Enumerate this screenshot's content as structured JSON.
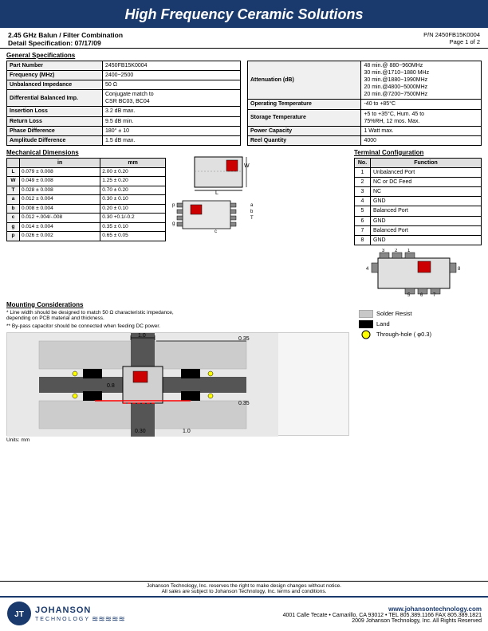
{
  "header": {
    "title": "High Frequency Ceramic Solutions"
  },
  "title_bar": {
    "product": "2.45 GHz Balun / Filter Combination",
    "part_number": "P/N 2450FB15K0004",
    "detail_spec": "Detail Specification:  07/17/09",
    "page": "Page 1 of 2"
  },
  "general_specs": {
    "title": "General Specifications",
    "left_table": [
      {
        "label": "Part Number",
        "value": "2450FB15K0004"
      },
      {
        "label": "Frequency (MHz)",
        "value": "2400~2500"
      },
      {
        "label": "Unbalanced Impedance",
        "value": "50 Ω"
      },
      {
        "label": "Differential Balanced Imp.",
        "value": "Conjugate match to\nCSR BC03, BC04"
      },
      {
        "label": "Insertion Loss",
        "value": "3.2 dB max."
      },
      {
        "label": "Return Loss",
        "value": "9.5 dB min."
      },
      {
        "label": "Phase Difference",
        "value": "180° ± 10"
      },
      {
        "label": "Amplitude Difference",
        "value": "1.5 dB max."
      }
    ],
    "right_table": [
      {
        "label": "Attenuation (dB)",
        "values": [
          "48 min.@ 880~960MHz",
          "30 min.@1710~1880 MHz",
          "30 min.@1880~1990MHz",
          "20 min.@4800~5000MHz",
          "20 min.@7200~7500MHz"
        ]
      },
      {
        "label": "Operating Temperature",
        "value": "-40 to +85°C"
      },
      {
        "label": "Storage Temperature",
        "value": "+5 to +35°C, Hum. 45 to\n75%RH, 12 mos. Max."
      },
      {
        "label": "Power Capacity",
        "value": "1 Watt max."
      },
      {
        "label": "Reel Quantity",
        "value": "4000"
      }
    ]
  },
  "mechanical": {
    "title": "Mechanical Dimensions",
    "dims_header": [
      "",
      "in",
      "mm"
    ],
    "dims": [
      {
        "label": "L",
        "in": "0.079  ±  0.008",
        "mm": "2.00  ±  0.20"
      },
      {
        "label": "W",
        "in": "0.049  ±  0.008",
        "mm": "1.25  ±  0.20"
      },
      {
        "label": "T",
        "in": "0.028  ±  0.008",
        "mm": "0.70  ±  0.20"
      },
      {
        "label": "a",
        "in": "0.012  ±  0.004",
        "mm": "0.30  ±  0.10"
      },
      {
        "label": "b",
        "in": "0.008  ±  0.004",
        "mm": "0.20  ±  0.10"
      },
      {
        "label": "c",
        "in": "0.012 +.004/-.008",
        "mm": "0.30  +0.1/-0.2"
      },
      {
        "label": "g",
        "in": "0.014  ±  0.004",
        "mm": "0.35  ±  0.10"
      },
      {
        "label": "p",
        "in": "0.026  ±  0.002",
        "mm": "0.65  ±  0.05"
      }
    ]
  },
  "terminal": {
    "title": "Terminal Configuration",
    "header": [
      "No.",
      "Function"
    ],
    "rows": [
      {
        "no": "1",
        "function": "Unbalanced Port"
      },
      {
        "no": "2",
        "function": "NC or DC Feed"
      },
      {
        "no": "3",
        "function": "NC"
      },
      {
        "no": "4",
        "function": "GND"
      },
      {
        "no": "5",
        "function": "Balanced Port"
      },
      {
        "no": "6",
        "function": "GND"
      },
      {
        "no": "7",
        "function": "Balanced Port"
      },
      {
        "no": "8",
        "function": "GND"
      }
    ]
  },
  "mounting": {
    "title": "Mounting Considerations",
    "notes": [
      "* Line width should be designed to match 50 Ω characteristic impedance, depending on PCB material and thickness.",
      "** By-pass capacitor should be connected when feeding DC power."
    ],
    "units": "Units: mm",
    "legend": [
      {
        "label": "Solder Resist",
        "color": "#c8c8c8"
      },
      {
        "label": "Land",
        "color": "#000000"
      },
      {
        "label": "Through-hole ( φ0.3)",
        "symbol": "circle"
      }
    ]
  },
  "footer": {
    "notice1": "Johanson Technology, Inc. reserves the right to make design changes without notice.",
    "notice2": "All sales are subject to Johanson Technology, Inc. terms and conditions.",
    "logo_main": "JOHANSON",
    "logo_sub": "TECHNOLOGY",
    "website": "www.johansontechnology.com",
    "address": "4001 Calle Tecate  •  Camarillo, CA 93012  •  TEL 805.389.1166 FAX 805.389.1821",
    "copyright": "2009 Johanson Technology, Inc.  All Rights Reserved"
  }
}
